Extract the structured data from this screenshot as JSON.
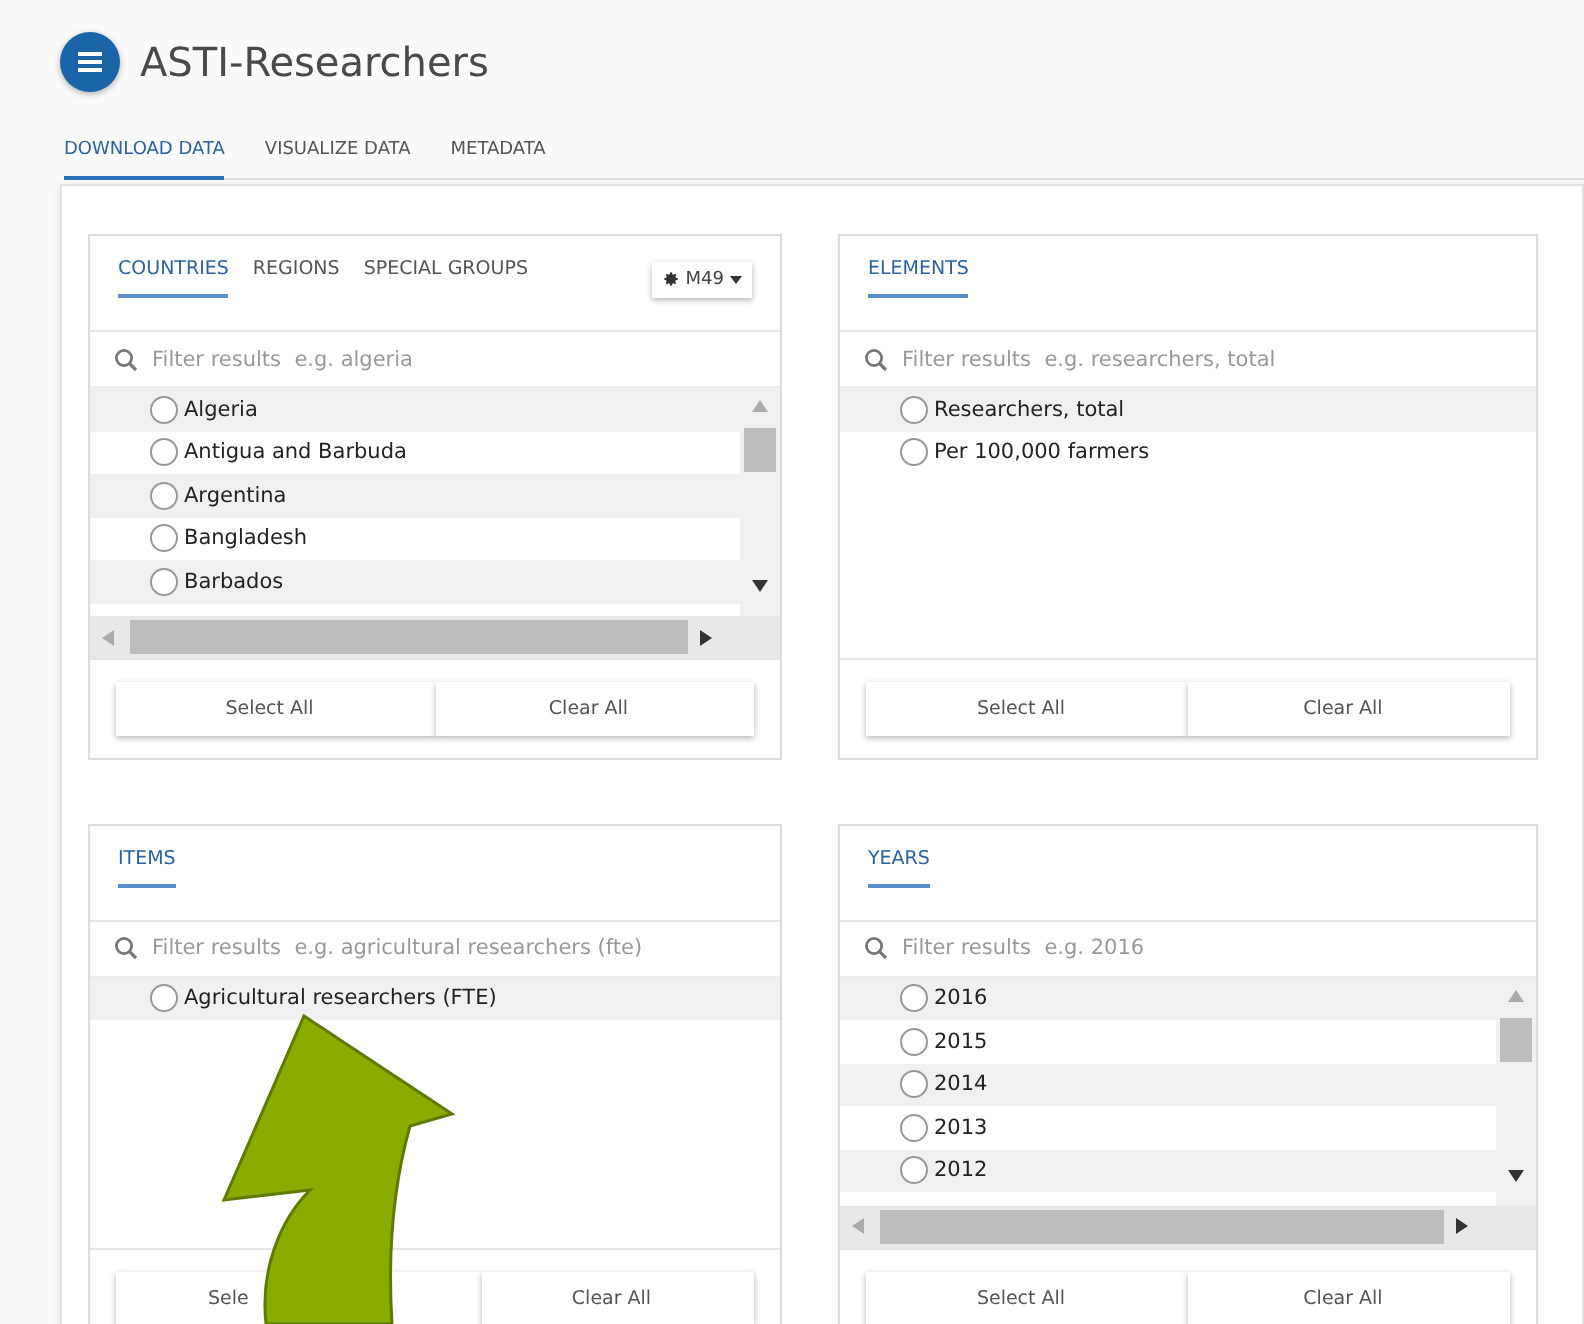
{
  "header": {
    "title": "ASTI-Researchers"
  },
  "tabs": [
    {
      "label": "DOWNLOAD DATA",
      "selected": true
    },
    {
      "label": "VISUALIZE DATA",
      "selected": false
    },
    {
      "label": "METADATA",
      "selected": false
    }
  ],
  "panels": [
    {
      "tabs": [
        {
          "label": "COUNTRIES",
          "selected": true
        },
        {
          "label": "REGIONS",
          "selected": false
        },
        {
          "label": "SPECIAL GROUPS",
          "selected": false
        }
      ],
      "settings_button": "M49",
      "search": {
        "placeholder": "Filter results  e.g. algeria"
      },
      "scrollbars": true,
      "rows": [
        {
          "label": "Algeria",
          "checked": false
        },
        {
          "label": "Antigua and Barbuda",
          "checked": false
        },
        {
          "label": "Argentina",
          "checked": false
        },
        {
          "label": "Bangladesh",
          "checked": false
        },
        {
          "label": "Barbados",
          "checked": false
        }
      ],
      "buttons": [
        {
          "label": "Select All"
        },
        {
          "label": "Clear All"
        }
      ]
    },
    {
      "tabs": [
        {
          "label": "ELEMENTS",
          "selected": true
        }
      ],
      "search": {
        "placeholder": "Filter results  e.g. researchers, total"
      },
      "scrollbars": false,
      "rows": [
        {
          "label": "Researchers, total",
          "checked": false
        },
        {
          "label": "Per 100,000 farmers",
          "checked": false
        }
      ],
      "buttons": [
        {
          "label": "Select All"
        },
        {
          "label": "Clear All"
        }
      ]
    },
    {
      "tabs": [
        {
          "label": "ITEMS",
          "selected": true
        }
      ],
      "search": {
        "placeholder": "Filter results  e.g. agricultural researchers (fte)"
      },
      "scrollbars": false,
      "rows": [
        {
          "label": "Agricultural researchers (FTE)",
          "checked": false
        }
      ],
      "buttons": [
        {
          "label": "Sele",
          "covered": true
        },
        {
          "label": "Clear All"
        }
      ]
    },
    {
      "tabs": [
        {
          "label": "YEARS",
          "selected": true
        }
      ],
      "search": {
        "placeholder": "Filter results  e.g. 2016"
      },
      "scrollbars": true,
      "rows": [
        {
          "label": "2016",
          "checked": false
        },
        {
          "label": "2015",
          "checked": false
        },
        {
          "label": "2014",
          "checked": false
        },
        {
          "label": "2013",
          "checked": false
        },
        {
          "label": "2012",
          "checked": false
        }
      ],
      "buttons": [
        {
          "label": "Select All"
        },
        {
          "label": "Clear All"
        }
      ]
    }
  ]
}
